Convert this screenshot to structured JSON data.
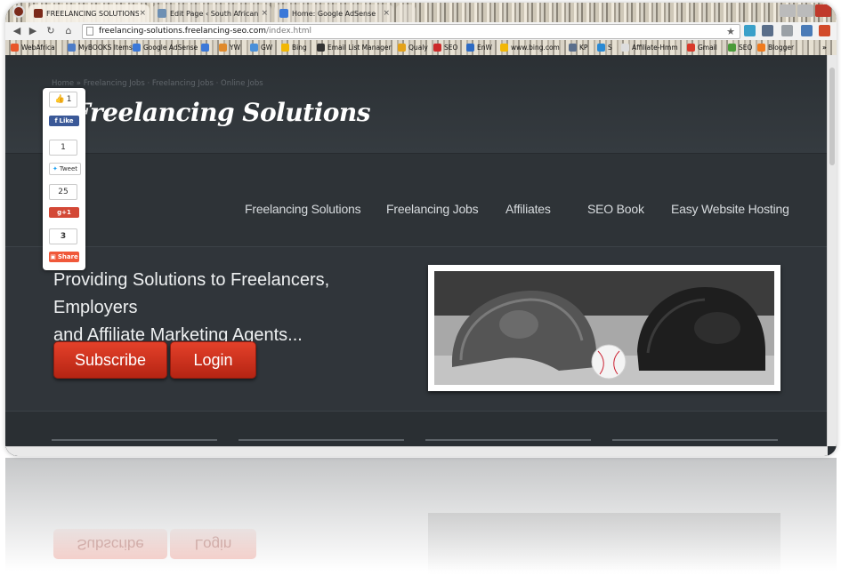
{
  "browser": {
    "tabs": [
      {
        "title": "FREELANCING SOLUTIONS",
        "fav_color": "#7b2a1a",
        "active": true
      },
      {
        "title": "Edit Page ‹ South African Or",
        "fav_color": "#6d8fb3",
        "active": false
      },
      {
        "title": "Home: Google AdSense",
        "fav_color": "#3b78d8",
        "active": false
      }
    ],
    "url_domain": "freelancing-solutions.freelancing-seo.com",
    "url_path": "/index.html",
    "bookmarks": [
      {
        "label": "WebAfrica",
        "color": "#e8562a"
      },
      {
        "label": "MyBOOKS Items",
        "color": "#4d7cc7"
      },
      {
        "label": "Google AdSense",
        "color": "#3b78d8"
      },
      {
        "label": "",
        "color": "#3b78d8"
      },
      {
        "label": "YW",
        "color": "#e08a2c"
      },
      {
        "label": "GW",
        "color": "#4a90d9"
      },
      {
        "label": "Bing",
        "color": "#f2b705"
      },
      {
        "label": "Email List Manager",
        "color": "#333333"
      },
      {
        "label": "Qualy",
        "color": "#e3a21a"
      },
      {
        "label": "SEO",
        "color": "#cc2a2a"
      },
      {
        "label": "EnW",
        "color": "#2d6bc4"
      },
      {
        "label": "www.bing.com",
        "color": "#f2b705"
      },
      {
        "label": "KP",
        "color": "#5b6f8c"
      },
      {
        "label": "S",
        "color": "#2a8ad4"
      },
      {
        "label": "Affiliate-Hmm",
        "color": "#dddddd"
      },
      {
        "label": "Gmail",
        "color": "#d93a2a"
      },
      {
        "label": "SEO",
        "color": "#4a9a3a"
      },
      {
        "label": "Blogger",
        "color": "#f07b1d"
      }
    ],
    "bookmarks_more": "»"
  },
  "site": {
    "breadcrumb": "Home » Freelancing Jobs · Freelancing Jobs · Online Jobs",
    "title": "Freelancing Solutions",
    "nav": [
      "Freelancing Solutions",
      "Freelancing Jobs",
      "Affiliates",
      "SEO Book",
      "Easy Website Hosting"
    ],
    "hero_line1": "Providing Solutions to Freelancers, Employers",
    "hero_line2": "and Affiliate Marketing Agents...",
    "subscribe_label": "Subscribe",
    "login_label": "Login"
  },
  "share": {
    "fb_count": "1",
    "fb_label": "Like",
    "tweet_count": "1",
    "tweet_label": "Tweet",
    "gplus_count": "25",
    "gplus_label": "+1",
    "share_count": "3",
    "share_label": "Share"
  },
  "colors": {
    "accent_red": "#d1321e",
    "page_bg": "#30353a",
    "nav_text": "#d7dbde"
  }
}
